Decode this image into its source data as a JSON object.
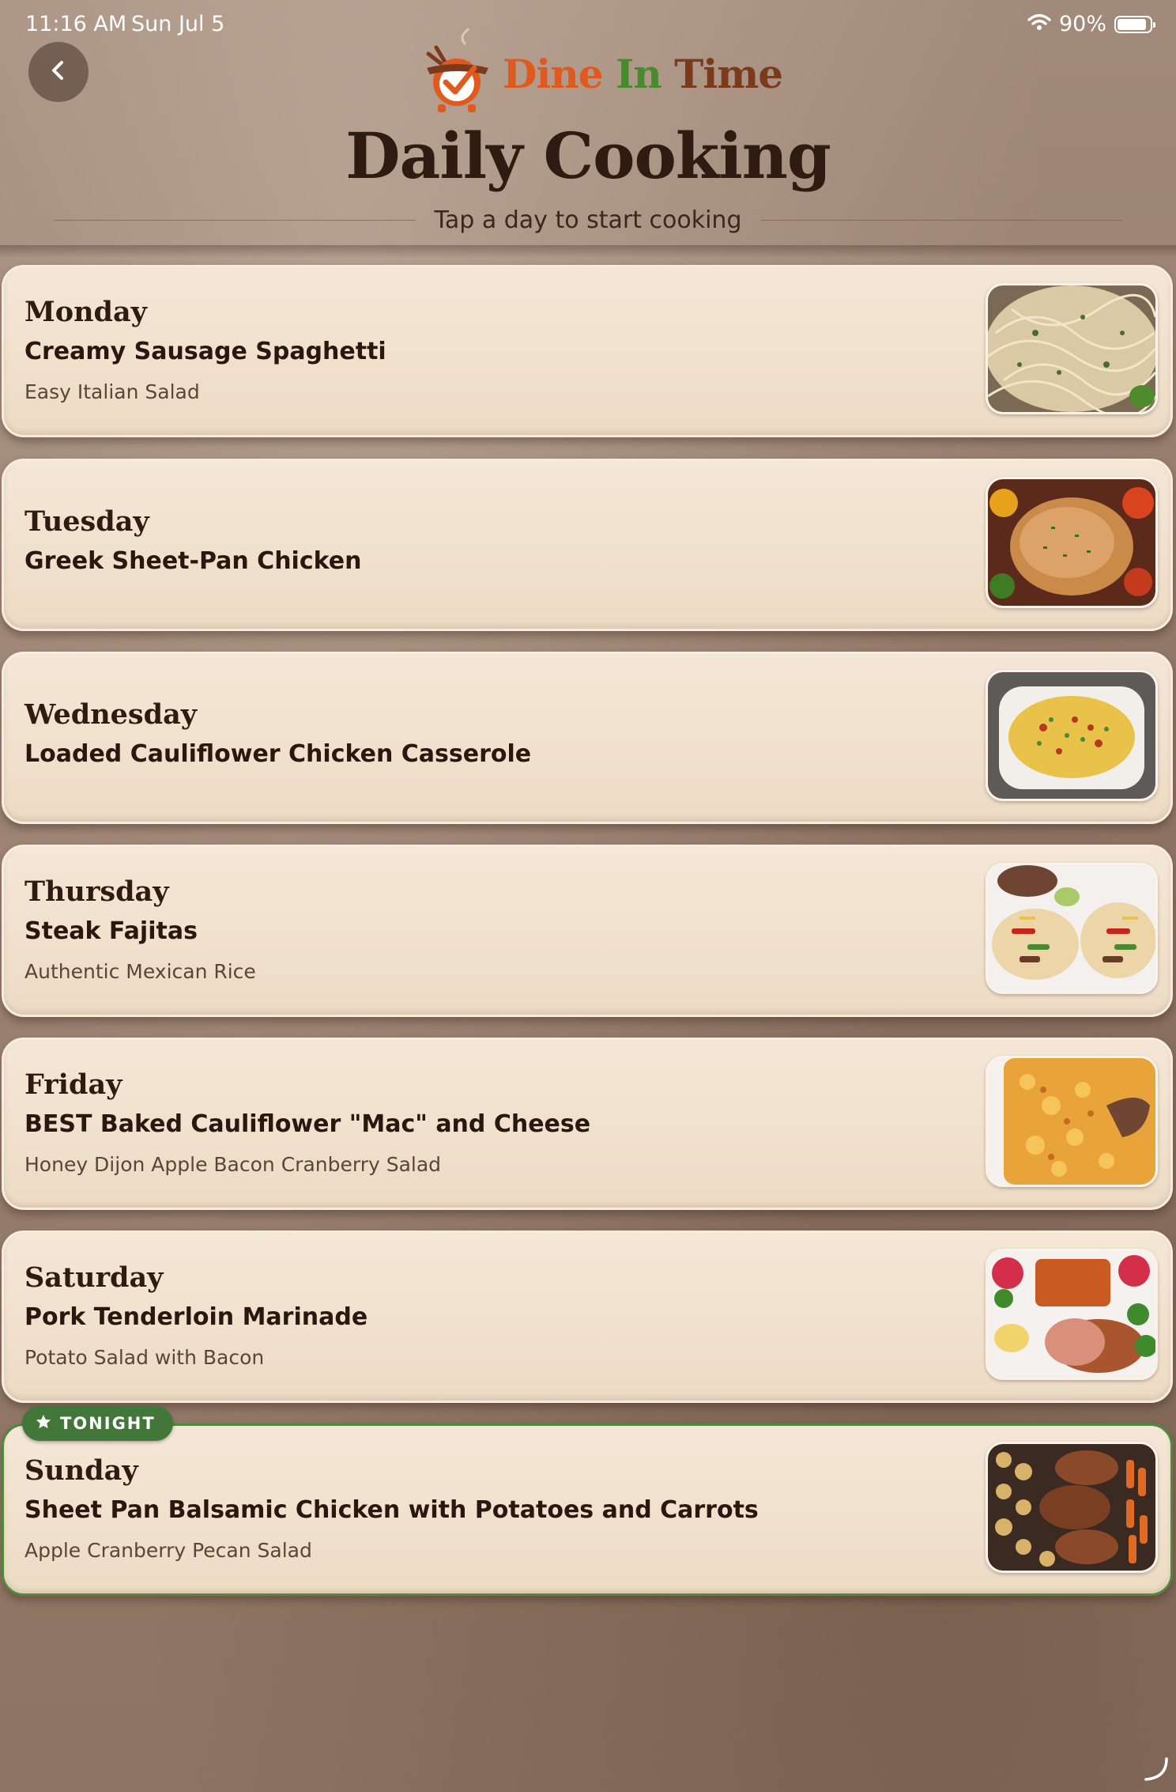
{
  "status_bar": {
    "time": "11:16 AM",
    "date": "Sun Jul 5",
    "battery": "90%",
    "battery_level": 0.9
  },
  "header": {
    "logo": {
      "dine": "Dine",
      "in": "In",
      "time": "Time"
    },
    "title": "Daily Cooking",
    "subtitle": "Tap a day to start cooking"
  },
  "colors": {
    "accent_orange": "#e0591f",
    "accent_green": "#4a8a2f",
    "title_brown": "#2e1b12",
    "tonight_green": "#43773a"
  },
  "days": [
    {
      "day": "Monday",
      "main": "Creamy Sausage Spaghetti",
      "side": "Easy Italian Salad",
      "thumb": "spaghetti-photo"
    },
    {
      "day": "Tuesday",
      "main": "Greek Sheet-Pan Chicken",
      "side": "",
      "thumb": "roast-chicken-photo"
    },
    {
      "day": "Wednesday",
      "main": "Loaded Cauliflower Chicken Casserole",
      "side": "",
      "thumb": "casserole-photo"
    },
    {
      "day": "Thursday",
      "main": "Steak Fajitas",
      "side": "Authentic Mexican Rice",
      "thumb": "fajitas-photo"
    },
    {
      "day": "Friday",
      "main": "BEST Baked Cauliflower \"Mac\" and Cheese",
      "side": "Honey Dijon Apple Bacon Cranberry Salad",
      "thumb": "mac-cheese-photo"
    },
    {
      "day": "Saturday",
      "main": "Pork Tenderloin Marinade",
      "side": "Potato Salad with Bacon",
      "thumb": "pork-tenderloin-photo"
    },
    {
      "day": "Sunday",
      "main": "Sheet Pan Balsamic Chicken with Potatoes and Carrots",
      "side": "Apple Cranberry Pecan Salad",
      "thumb": "balsamic-chicken-photo"
    }
  ],
  "tonight_badge": "TONIGHT",
  "icons": {
    "back": "chevron-left-icon",
    "badge": "star-icon",
    "wifi": "wifi-icon",
    "battery": "battery-icon",
    "resize": "resize-corner-icon"
  }
}
